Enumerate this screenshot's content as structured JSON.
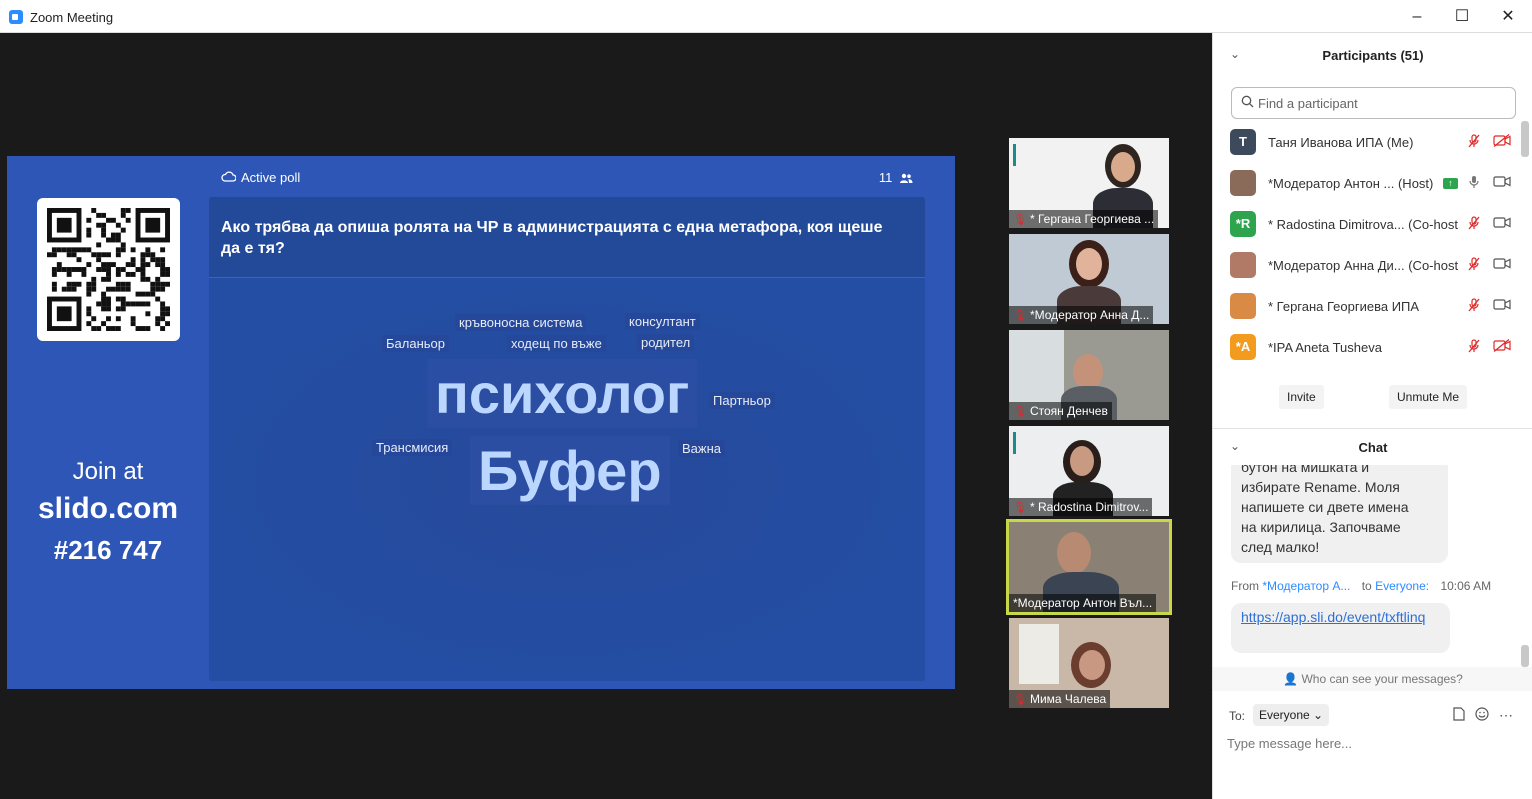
{
  "window": {
    "title": "Zoom Meeting",
    "minimize": "–",
    "maximize": "☐",
    "close": "✕"
  },
  "slide": {
    "join_at": "Join at",
    "join_url": "slido.com",
    "join_code": "#216 747",
    "poll_label": "Active poll",
    "participant_count": "11",
    "question": "Ако трябва да опиша ролята на ЧР в администрацията с една метафора, коя щеше да е тя?",
    "words": {
      "w1": "кръвоносна система",
      "w2": "консултант",
      "w3": "Баланьор",
      "w4": "ходещ по въже",
      "w5": "родител",
      "w6": "психолог",
      "w7": "Партньор",
      "w8": "Трансмисия",
      "w9": "Буфер",
      "w10": "Важна"
    }
  },
  "thumbnails": [
    {
      "name": "* Гергана Георгиева ..."
    },
    {
      "name": "*Модератор Анна Д..."
    },
    {
      "name": "Стоян Денчев"
    },
    {
      "name": "* Radostina Dimitrov..."
    },
    {
      "name": "*Модератор Антон Въл..."
    },
    {
      "name": "Мима Чалева"
    }
  ],
  "participants": {
    "title": "Participants (51)",
    "search_placeholder": "Find a participant",
    "list": [
      {
        "initials": "T",
        "name": "Таня Иванова ИПА (Me)",
        "color": "#3d4a5c"
      },
      {
        "initials": "",
        "name": "*Модератор Антон ... (Host)",
        "color": "#8a6a58"
      },
      {
        "initials": "*R",
        "name": "* Radostina Dimitrova... (Co-host)",
        "color": "#2ea44f"
      },
      {
        "initials": "",
        "name": "*Модератор Анна Ди... (Co-host)",
        "color": "#b07a66"
      },
      {
        "initials": "",
        "name": "* Гергана Георгиева ИПА",
        "color": "#d98a44"
      },
      {
        "initials": "*A",
        "name": "*IPA Aneta Tusheva",
        "color": "#f29b1d"
      }
    ],
    "invite": "Invite",
    "unmute": "Unmute Me"
  },
  "chat": {
    "title": "Chat",
    "message_partial": [
      "бутон на мишката и",
      "избирате Rename. Моля",
      "напишете си двете имена",
      "на кирилица. Започваме",
      "след малко!"
    ],
    "from_label": "From",
    "from_name": "*Модератор А...",
    "to_label": "to",
    "to_name": "Everyone:",
    "time": "10:06 AM",
    "link": "https://app.sli.do/event/txftlinq",
    "who_can_see": "Who can see your messages?",
    "to_select_label": "To:",
    "to_select_value": "Everyone",
    "input_placeholder": "Type message here..."
  }
}
